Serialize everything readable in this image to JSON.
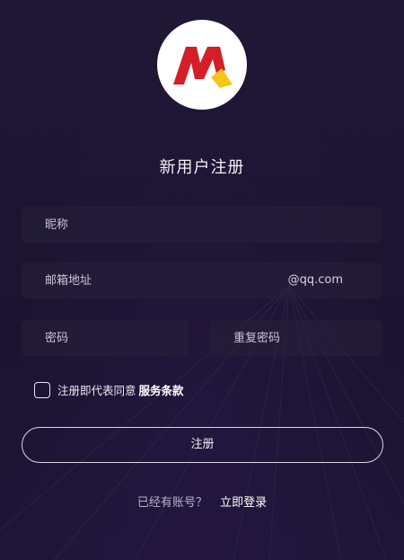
{
  "logo": {
    "icon": "brand-logo-icon",
    "primary_color": "#d41f26",
    "accent_color": "#f5c518"
  },
  "title": "新用户注册",
  "fields": {
    "nickname_placeholder": "昵称",
    "email_placeholder": "邮箱地址",
    "email_suffix": "@qq.com",
    "password_placeholder": "密码",
    "confirm_password_placeholder": "重复密码"
  },
  "agreement": {
    "text": "注册即代表同意",
    "terms_link": "服务条款",
    "checked": false
  },
  "register_button": "注册",
  "login": {
    "question": "已经有账号？",
    "link": "立即登录"
  }
}
